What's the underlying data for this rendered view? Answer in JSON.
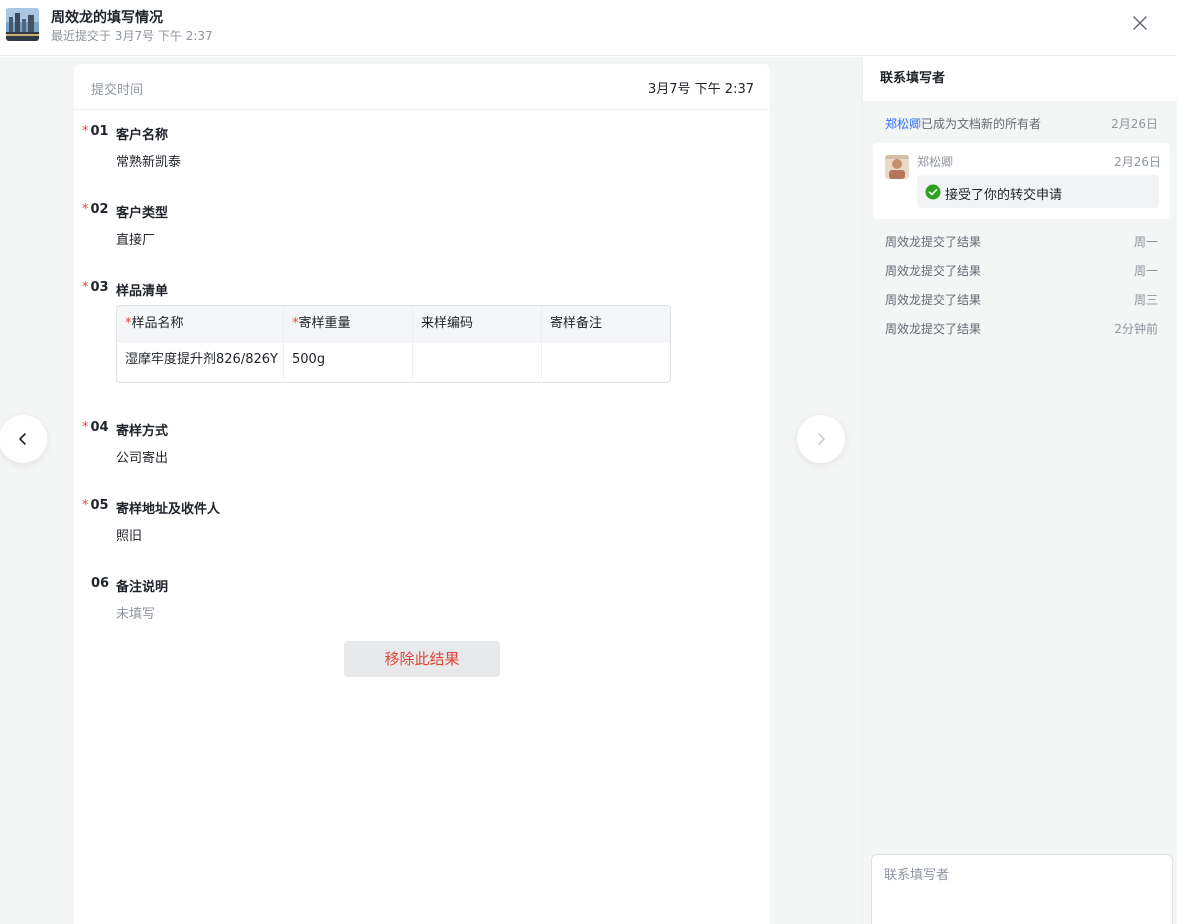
{
  "header": {
    "title": "周效龙的填写情况",
    "subtitle": "最近提交于 3月7号 下午 2:37"
  },
  "card": {
    "submit_time_label": "提交时间",
    "submit_time_value": "3月7号 下午 2:37"
  },
  "questions": [
    {
      "number": "01",
      "required": true,
      "title": "客户名称",
      "answer": "常熟新凯泰"
    },
    {
      "number": "02",
      "required": true,
      "title": "客户类型",
      "answer": "直接厂"
    },
    {
      "number": "03",
      "required": true,
      "title": "样品清单"
    },
    {
      "number": "04",
      "required": true,
      "title": "寄样方式",
      "answer": "公司寄出"
    },
    {
      "number": "05",
      "required": true,
      "title": "寄样地址及收件人",
      "answer": "照旧"
    },
    {
      "number": "06",
      "required": false,
      "title": "备注说明",
      "answer": "未填写"
    }
  ],
  "required_mark": "*",
  "sample_table": {
    "columns": [
      {
        "label": "样品名称",
        "required": true
      },
      {
        "label": "寄样重量",
        "required": true
      },
      {
        "label": "来样编码",
        "required": false
      },
      {
        "label": "寄样备注",
        "required": false
      }
    ],
    "rows": [
      [
        "湿摩牢度提升剂826/826Y",
        "500g",
        "",
        ""
      ]
    ]
  },
  "remove_button_label": "移除此结果",
  "sidebar": {
    "title": "联系填写者",
    "ownership": {
      "user": "郑松卿",
      "text": "已成为文档新的所有者",
      "time": "2月26日"
    },
    "comment": {
      "user": "郑松卿",
      "time": "2月26日",
      "text": "接受了你的转交申请"
    },
    "activities": [
      {
        "text": "周效龙提交了结果",
        "time": "周一"
      },
      {
        "text": "周效龙提交了结果",
        "time": "周一"
      },
      {
        "text": "周效龙提交了结果",
        "time": "周三"
      },
      {
        "text": "周效龙提交了结果",
        "time": "2分钟前"
      }
    ],
    "input_placeholder": "联系填写者"
  },
  "icons": {
    "close": "close-icon",
    "prev": "chevron-left-icon",
    "next": "chevron-right-icon",
    "check": "check-circle-icon"
  },
  "colors": {
    "required_star": "#e0443b",
    "link": "#3370ff",
    "success": "#2ea121",
    "remove_text": "#e0443b"
  }
}
